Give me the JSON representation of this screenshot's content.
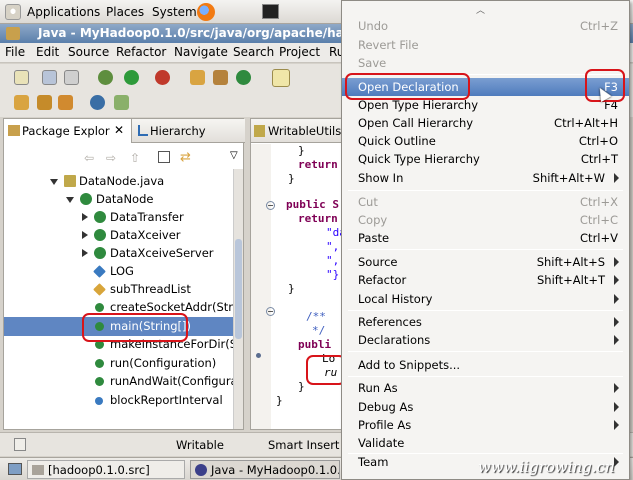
{
  "gnome": {
    "applications": "Applications",
    "places": "Places",
    "system": "System"
  },
  "window": {
    "title": "Java - MyHadoop0.1.0/src/java/org/apache/hadoop/"
  },
  "menubar": [
    "File",
    "Edit",
    "Source",
    "Refactor",
    "Navigate",
    "Search",
    "Project",
    "Ru"
  ],
  "left_pane": {
    "tab_package": "Package Explor",
    "tab_hierarchy": "Hierarchy",
    "tree": [
      {
        "label": "DataNode.java"
      },
      {
        "label": "DataNode"
      },
      {
        "label": "DataTransfer"
      },
      {
        "label": "DataXceiver"
      },
      {
        "label": "DataXceiveServer"
      },
      {
        "label": "LOG"
      },
      {
        "label": "subThreadList"
      },
      {
        "label": "createSocketAddr(Stri"
      },
      {
        "label": "main(String[])"
      },
      {
        "label": "makeInstanceForDir(St"
      },
      {
        "label": "run(Configuration)"
      },
      {
        "label": "runAndWait(Configurat"
      },
      {
        "label": "blockReportInterval"
      }
    ]
  },
  "editor": {
    "tab": "WritableUtils",
    "code": [
      "}",
      "return",
      "}",
      "public S",
      "return",
      "\"da",
      "\",",
      "\",",
      "\"}",
      "}",
      "/**",
      "*/",
      "publi",
      "Lo",
      "ru",
      "}",
      "}"
    ]
  },
  "status": {
    "writable": "Writable",
    "insert": "Smart Insert"
  },
  "taskbar": {
    "item1": "[hadoop0.1.0.src]",
    "item2": "Java - MyHadoop0.1.0..."
  },
  "context_menu": [
    {
      "label": "Undo",
      "shortcut": "Ctrl+Z",
      "disabled": true
    },
    {
      "label": "Revert File",
      "shortcut": "",
      "disabled": true
    },
    {
      "label": "Save",
      "shortcut": "",
      "disabled": true
    },
    {
      "label": "Open Declaration",
      "shortcut": "F3",
      "highlighted": true
    },
    {
      "label": "Open Type Hierarchy",
      "shortcut": "F4"
    },
    {
      "label": "Open Call Hierarchy",
      "shortcut": "Ctrl+Alt+H"
    },
    {
      "label": "Quick Outline",
      "shortcut": "Ctrl+O"
    },
    {
      "label": "Quick Type Hierarchy",
      "shortcut": "Ctrl+T"
    },
    {
      "label": "Show In",
      "shortcut": "Shift+Alt+W"
    },
    {
      "label": "Cut",
      "shortcut": "Ctrl+X",
      "disabled": true
    },
    {
      "label": "Copy",
      "shortcut": "Ctrl+C",
      "disabled": true
    },
    {
      "label": "Paste",
      "shortcut": "Ctrl+V"
    },
    {
      "label": "Source",
      "shortcut": "Shift+Alt+S"
    },
    {
      "label": "Refactor",
      "shortcut": "Shift+Alt+T"
    },
    {
      "label": "Local History",
      "shortcut": ""
    },
    {
      "label": "References",
      "shortcut": ""
    },
    {
      "label": "Declarations",
      "shortcut": ""
    },
    {
      "label": "Add to Snippets...",
      "shortcut": ""
    },
    {
      "label": "Run As",
      "shortcut": ""
    },
    {
      "label": "Debug As",
      "shortcut": ""
    },
    {
      "label": "Profile As",
      "shortcut": ""
    },
    {
      "label": "Validate",
      "shortcut": ""
    },
    {
      "label": "Team",
      "shortcut": ""
    }
  ],
  "watermark": "www.iigrowing.cn",
  "colors": {
    "highlight": "#5b86c5",
    "selection": "#5f86c2",
    "annotation": "#d8141a"
  }
}
